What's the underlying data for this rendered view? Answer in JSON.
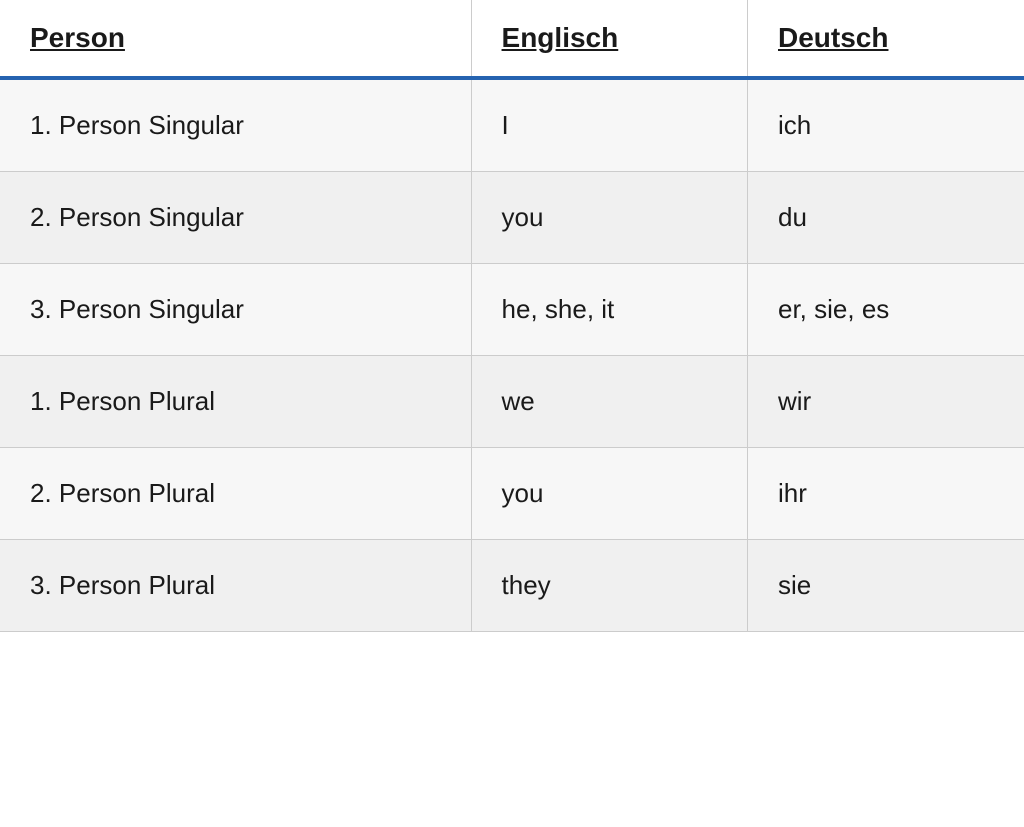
{
  "table": {
    "headers": {
      "person": "Person",
      "english": "Englisch",
      "deutsch": "Deutsch"
    },
    "rows": [
      {
        "person": "1. Person Singular",
        "english": "I",
        "deutsch": "ich"
      },
      {
        "person": "2. Person Singular",
        "english": "you",
        "deutsch": "du"
      },
      {
        "person": "3. Person Singular",
        "english": "he, she, it",
        "deutsch": "er, sie, es"
      },
      {
        "person": "1. Person Plural",
        "english": "we",
        "deutsch": "wir"
      },
      {
        "person": "2. Person Plural",
        "english": "you",
        "deutsch": "ihr"
      },
      {
        "person": "3. Person Plural",
        "english": "they",
        "deutsch": "sie"
      }
    ]
  }
}
